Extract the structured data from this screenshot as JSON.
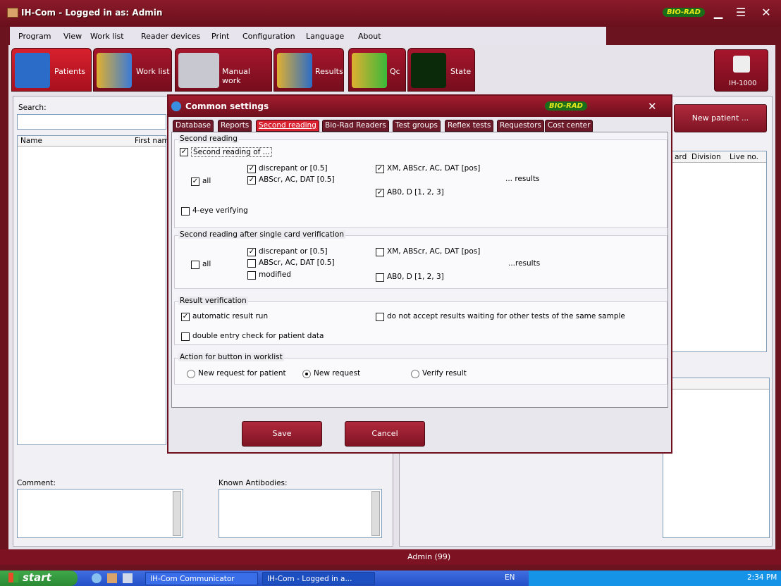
{
  "app": {
    "title": "IH-Com - Logged in as: Admin",
    "brand": "BIO-RAD"
  },
  "menu": [
    "Program",
    "View",
    "Work list",
    "Reader devices",
    "Print",
    "Configuration",
    "Language",
    "About"
  ],
  "toolbar": {
    "patients": "Patients",
    "worklist": "Work list",
    "manual_work": "Manual work",
    "results": "Results",
    "qc": "Qc",
    "state": "State",
    "device": "IH-1000"
  },
  "left_panel": {
    "search_label": "Search:",
    "col_name": "Name",
    "col_first": "First nam",
    "comment_label": "Comment:",
    "antibodies_label": "Known Antibodies:"
  },
  "right_panel": {
    "new_patient": "New patient ...",
    "col_card": "ard",
    "col_division": "Division",
    "col_liveno": "Live no."
  },
  "dialog": {
    "title": "Common settings",
    "tabs": [
      "Database",
      "Reports",
      "Second reading",
      "Bio-Rad Readers",
      "Test groups",
      "Reflex tests",
      "Requestors",
      "Cost center"
    ],
    "active_tab": "Second reading",
    "sec1": {
      "label": "Second reading",
      "main": "Second reading of ...",
      "all": "all",
      "discrepant": "discrepant or [0.5]",
      "abscr": "ABScr, AC, DAT [0.5]",
      "xm": "XM, ABScr, AC, DAT [pos]",
      "abo": "AB0, D [1, 2, 3]",
      "results": "... results",
      "foureye": "4-eye verifying"
    },
    "sec2": {
      "label": "Second reading after single card verification",
      "all": "all",
      "discrepant": "discrepant or [0.5]",
      "abscr": "ABScr, AC, DAT [0.5]",
      "modified": "modified",
      "xm": "XM, ABScr, AC, DAT [pos]",
      "abo": "AB0, D [1, 2, 3]",
      "results": "...results"
    },
    "sec3": {
      "label": "Result verification",
      "auto": "automatic result run",
      "noaccept": "do not accept results waiting for other tests of the same sample",
      "double": "double entry check for patient data"
    },
    "sec4": {
      "label": "Action for button in worklist",
      "opt1": "New request for patient",
      "opt2": "New request",
      "opt3": "Verify result"
    },
    "save": "Save",
    "cancel": "Cancel"
  },
  "status": {
    "user": "Admin (99)"
  },
  "taskbar": {
    "start": "start",
    "item1": "IH-Com Communicator",
    "item2": "IH-Com - Logged in a...",
    "lang": "EN",
    "time": "2:34 PM"
  }
}
